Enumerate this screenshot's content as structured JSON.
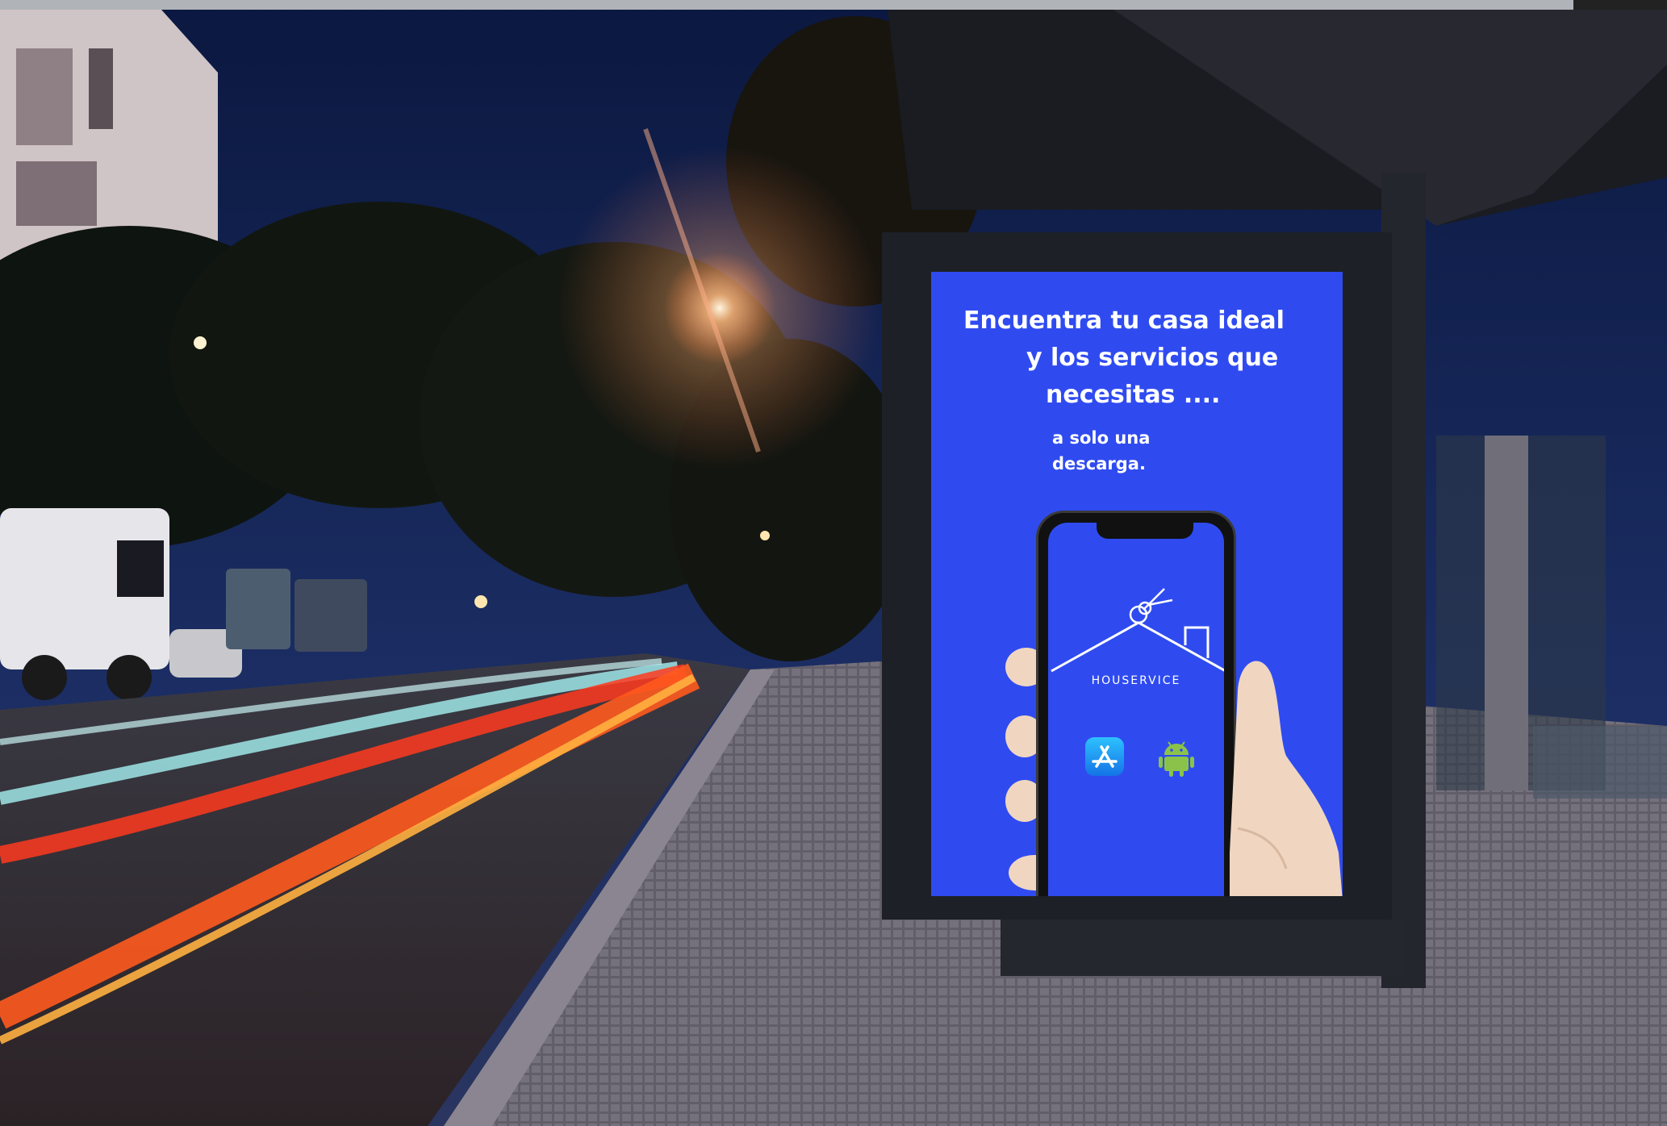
{
  "poster": {
    "headline": [
      "Encuentra tu casa ideal",
      "y  los servicios que",
      "necesitas ...."
    ],
    "subline": [
      "a solo una",
      "descarga."
    ]
  },
  "phone": {
    "brand": "HOUSERVICE",
    "icons": [
      "app-store-icon",
      "android-icon"
    ]
  },
  "colors": {
    "poster_blue": "#2f4bf0",
    "sky": "#0f1c4a",
    "streetlight": "#ffd9a0",
    "light_trail_red": "#ff3a1e",
    "light_trail_cyan": "#9fe6e8"
  }
}
